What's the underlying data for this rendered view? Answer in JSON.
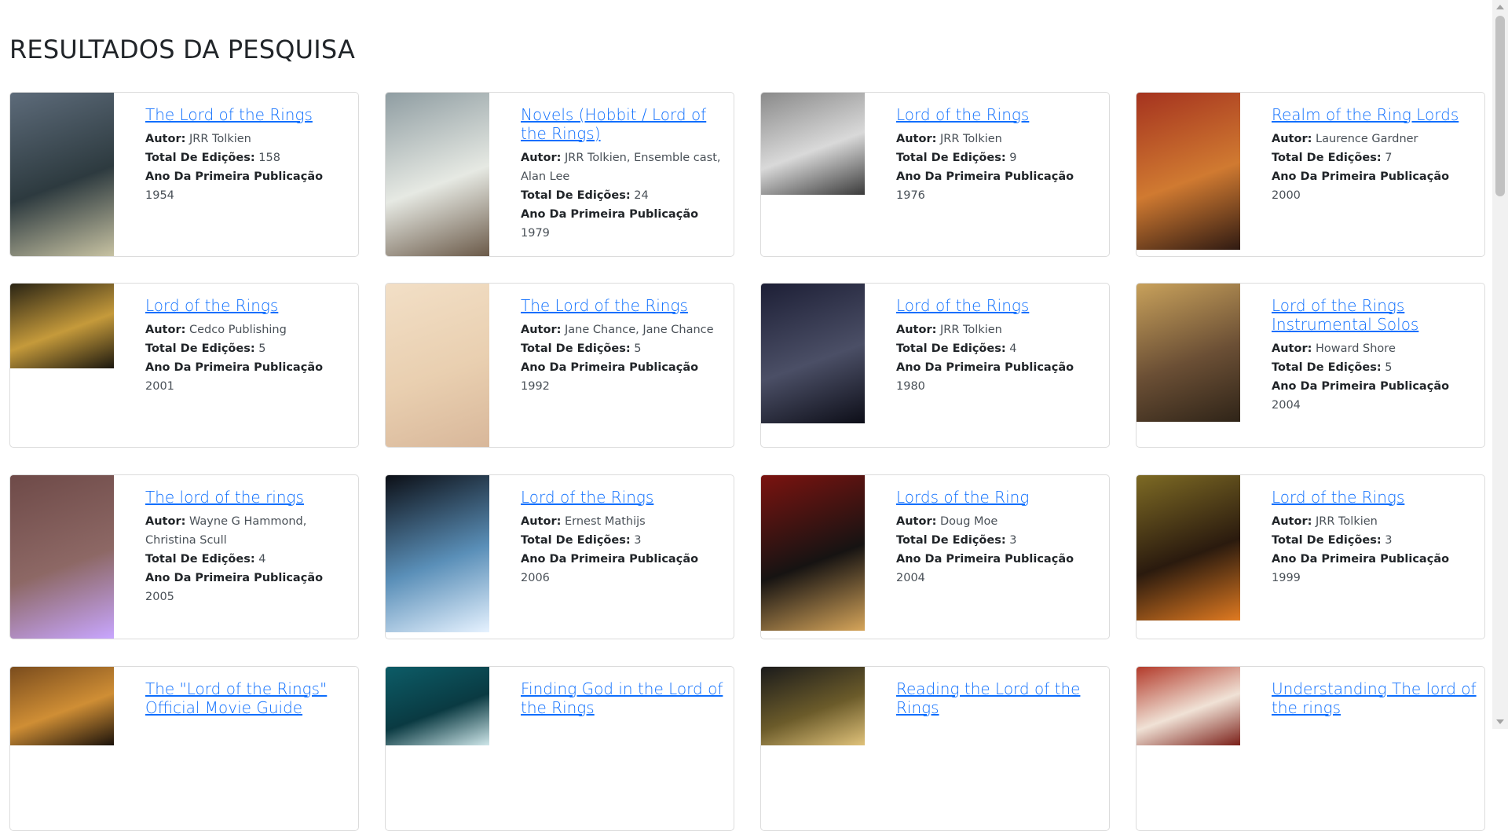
{
  "heading": "RESULTADOS DA PESQUISA",
  "labels": {
    "author": "Autor:",
    "editions": "Total De Edições:",
    "first_year": "Ano Da Primeira Publicação"
  },
  "books": [
    {
      "title": "The Lord of the Rings",
      "author": "JRR Tolkien",
      "editions": "158",
      "year": "1954",
      "cover_colors": [
        "#5d6b7a",
        "#2d3a3f",
        "#c7c2a2"
      ]
    },
    {
      "title": "Novels (Hobbit / Lord of the Rings)",
      "author": "JRR Tolkien, Ensemble cast, Alan Lee",
      "editions": "24",
      "year": "1979",
      "cover_colors": [
        "#8f9da2",
        "#e6e9e3",
        "#6b5a49"
      ]
    },
    {
      "title": "Lord of the Rings",
      "author": "JRR Tolkien",
      "editions": "9",
      "year": "1976",
      "cover_colors": [
        "#8a8a8a",
        "#d9d9d9",
        "#3a3a3a"
      ]
    },
    {
      "title": "Realm of the Ring Lords",
      "author": "Laurence Gardner",
      "editions": "7",
      "year": "2000",
      "cover_colors": [
        "#a5331f",
        "#d07a31",
        "#2f1a12"
      ]
    },
    {
      "title": "Lord of the Rings",
      "author": "Cedco Publishing",
      "editions": "5",
      "year": "2001",
      "cover_colors": [
        "#2a2414",
        "#c59a3b",
        "#1c180f"
      ]
    },
    {
      "title": "The Lord of the Rings",
      "author": "Jane Chance, Jane Chance",
      "editions": "5",
      "year": "1992",
      "cover_colors": [
        "#f2dfc6",
        "#e9cfb0",
        "#d8b79a"
      ]
    },
    {
      "title": "Lord of the Rings",
      "author": "JRR Tolkien",
      "editions": "4",
      "year": "1980",
      "cover_colors": [
        "#1d1f36",
        "#4b4f66",
        "#0d0e18"
      ]
    },
    {
      "title": "Lord of the Rings Instrumental Solos",
      "author": "Howard Shore",
      "editions": "5",
      "year": "2004",
      "cover_colors": [
        "#c8a15b",
        "#6b4f35",
        "#2f2418"
      ]
    },
    {
      "title": "The lord of the rings",
      "author": "Wayne G Hammond, Christina Scull",
      "editions": "4",
      "year": "2005",
      "cover_colors": [
        "#6e4a48",
        "#8d6865",
        "#c8a6ff"
      ]
    },
    {
      "title": "Lord of the Rings",
      "author": "Ernest Mathijs",
      "editions": "3",
      "year": "2006",
      "cover_colors": [
        "#0c0f16",
        "#5a8fb8",
        "#e6f2ff"
      ]
    },
    {
      "title": "Lords of the Ring",
      "author": "Doug Moe",
      "editions": "3",
      "year": "2004",
      "cover_colors": [
        "#7b1310",
        "#161312",
        "#d6a55a"
      ]
    },
    {
      "title": "Lord of the Rings",
      "author": "JRR Tolkien",
      "editions": "3",
      "year": "1999",
      "cover_colors": [
        "#7d6a24",
        "#2a1a0e",
        "#e07a21"
      ]
    },
    {
      "title": "The \"Lord of the Rings\" Official Movie Guide",
      "author": "",
      "editions": "",
      "year": "",
      "cover_colors": [
        "#7a4c1d",
        "#cf8e35",
        "#1b120b"
      ]
    },
    {
      "title": "Finding God in the Lord of the Rings",
      "author": "",
      "editions": "",
      "year": "",
      "cover_colors": [
        "#0c5c67",
        "#0a3a42",
        "#cfe7ea"
      ]
    },
    {
      "title": "Reading the Lord of the Rings",
      "author": "",
      "editions": "",
      "year": "",
      "cover_colors": [
        "#1b1b1b",
        "#6b5b2a",
        "#e0c27a"
      ]
    },
    {
      "title": "Understanding The lord of the rings",
      "author": "",
      "editions": "",
      "year": "",
      "cover_colors": [
        "#b33b2b",
        "#f0e2d6",
        "#7a1f18"
      ]
    }
  ],
  "colors": {
    "link": "#0d6efd",
    "border": "#dcdcdc",
    "text": "#212529",
    "muted": "#495057"
  }
}
